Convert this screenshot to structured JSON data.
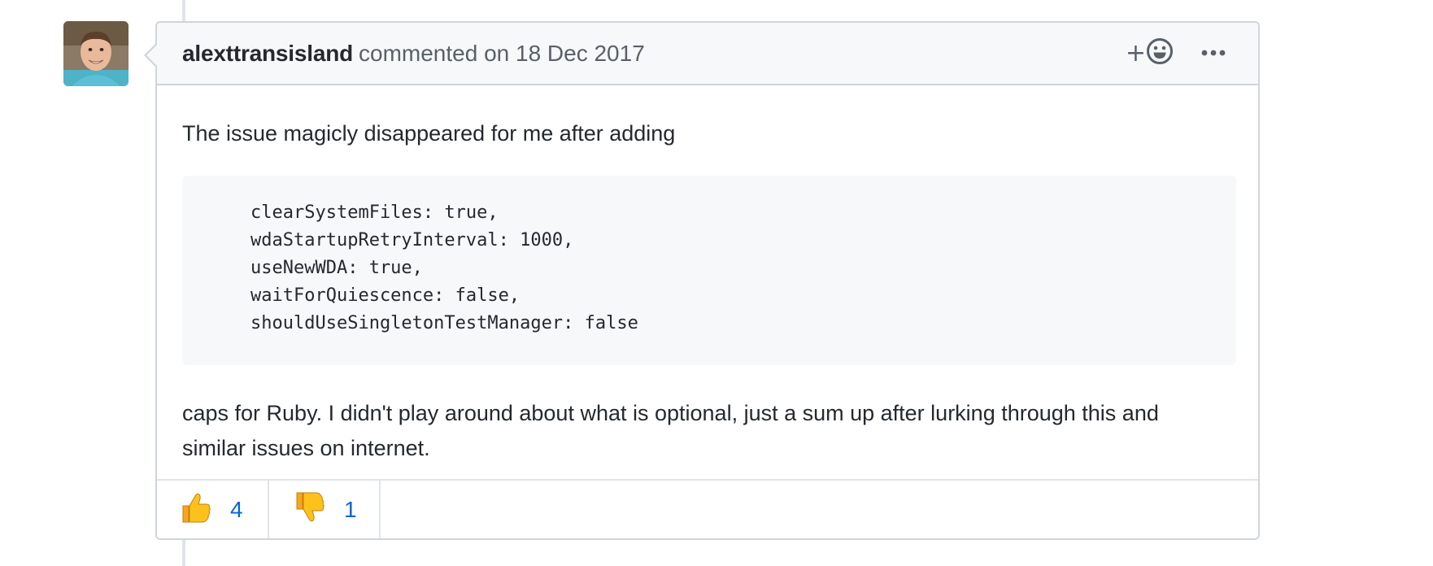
{
  "comment": {
    "author": "alexttransisland",
    "meta": "commented on 18 Dec 2017",
    "header_actions": {
      "add_reaction_label": "+",
      "add_reaction_icon": "smiley-icon",
      "more_icon": "kebab-horizontal-icon"
    },
    "body": {
      "intro": "The issue magicly disappeared for me after adding",
      "code_lines": [
        "clearSystemFiles: true,",
        "wdaStartupRetryInterval: 1000,",
        "useNewWDA: true,",
        "waitForQuiescence: false,",
        "shouldUseSingletonTestManager: false"
      ],
      "outro_line1": "caps for Ruby. I didn't play around about what is optional, just a sum up after lurking through this and",
      "outro_line2": "similar issues on internet."
    },
    "reactions": [
      {
        "icon": "thumbs-up-icon",
        "count": "4"
      },
      {
        "icon": "thumbs-down-icon",
        "count": "1"
      }
    ]
  },
  "colors": {
    "link_blue": "#0366d6",
    "border": "#d1d5da",
    "header_bg": "#f6f8fa",
    "emoji_yellow": "#f4b400"
  }
}
